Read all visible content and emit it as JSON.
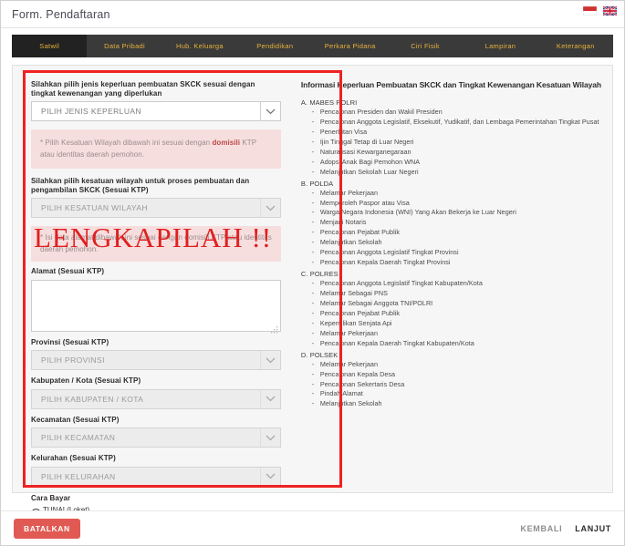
{
  "window": {
    "title": "Form. Pendaftaran"
  },
  "language_flags": [
    {
      "name": "indonesia-flag",
      "label": "Bahasa Indonesia"
    },
    {
      "name": "uk-flag",
      "label": "English"
    }
  ],
  "tabs": [
    {
      "label": "Satwil",
      "active": true
    },
    {
      "label": "Data Pribadi",
      "active": false
    },
    {
      "label": "Hub. Keluarga",
      "active": false
    },
    {
      "label": "Pendidikan",
      "active": false
    },
    {
      "label": "Perkara Pidana",
      "active": false
    },
    {
      "label": "Ciri Fisik",
      "active": false
    },
    {
      "label": "Lampiran",
      "active": false
    },
    {
      "label": "Keterangan",
      "active": false
    }
  ],
  "form": {
    "keperluan": {
      "label": "Silahkan pilih jenis keperluan pembuatan SKCK sesuai dengan tingkat kewenangan yang diperlukan",
      "value": "PILIH JENIS KEPERLUAN",
      "disabled": false
    },
    "alert_wilayah": {
      "prefix": "* Pilih Kesatuan Wilayah dibawah ini sesuai dengan ",
      "highlight": "domisili",
      "suffix": " KTP atau identitas daerah pemohon."
    },
    "kesatuan_wilayah": {
      "label": "Silahkan pilih kesatuan wilayah untuk proses pembuatan dan pengambilan SKCK (Sesuai KTP)",
      "value": "PILIH KESATUAN WILAYAH",
      "disabled": true
    },
    "alert_alamat": {
      "text": "* Isi data alamat dibawah ini sesuai dengan domisili KTP atau identitas daerah pemohon."
    },
    "alamat": {
      "label": "Alamat (Sesuai KTP)",
      "value": ""
    },
    "provinsi": {
      "label": "Provinsi (Sesuai KTP)",
      "value": "PILIH PROVINSI",
      "disabled": true
    },
    "kabupaten": {
      "label": "Kabupaten / Kota (Sesuai KTP)",
      "value": "PILIH KABUPATEN / KOTA",
      "disabled": true
    },
    "kecamatan": {
      "label": "Kecamatan (Sesuai KTP)",
      "value": "PILIH KECAMATAN",
      "disabled": true
    },
    "kelurahan": {
      "label": "Kelurahan (Sesuai KTP)",
      "value": "PILIH KELURAHAN",
      "disabled": true
    },
    "cara_bayar": {
      "label": "Cara Bayar",
      "option": "TUNAI (Loket)",
      "selected": true
    }
  },
  "info": {
    "title": "Informasi Keperluan Pembuatan SKCK dan Tingkat Kewenangan Kesatuan Wilayah",
    "groups": [
      {
        "heading": "A. MABES POLRI",
        "items": [
          "Pencalonan Presiden dan Wakil Presiden",
          "Pencalonan Anggota Legislatif, Eksekutif, Yudikatif, dan Lembaga Pemerintahan Tingkat Pusat",
          "Penerbitan Visa",
          "Ijin Tinggal Tetap di Luar Negeri",
          "Naturalisasi Kewarganegaraan",
          "Adopsi Anak Bagi Pemohon WNA",
          "Melanjutkan Sekolah Luar Negeri"
        ]
      },
      {
        "heading": "B. POLDA",
        "items": [
          "Melamar Pekerjaan",
          "Memperoleh Paspor atau Visa",
          "Warga Negara Indonesia (WNI) Yang Akan Bekerja ke Luar Negeri",
          "Menjadi Notaris",
          "Pencalonan Pejabat Publik",
          "Melanjutkan Sekolah",
          "Pencalonan Anggota Legislatif Tingkat Provinsi",
          "Pencalonan Kepala Daerah Tingkat Provinsi"
        ]
      },
      {
        "heading": "C. POLRES",
        "items": [
          "Pencalonan Anggota Legislatif Tingkat Kabupaten/Kota",
          "Melamar Sebagai PNS",
          "Melamar Sebagai Anggota TNI/POLRI",
          "Pencalonan Pejabat Publik",
          "Kepemilikan Senjata Api",
          "Melamar Pekerjaan",
          "Pencalonan Kepala Daerah Tingkat Kabupaten/Kota"
        ]
      },
      {
        "heading": "D. POLSEK",
        "items": [
          "Melamar Pekerjaan",
          "Pencalonan Kepala Desa",
          "Pencalonan Sekertaris Desa",
          "Pindah Alamat",
          "Melanjutkan Sekolah"
        ]
      }
    ]
  },
  "annotation": {
    "overlay_text": "LENGKAPILAH !!",
    "box_color": "#ee2222",
    "text_color": "#e02020"
  },
  "footer": {
    "cancel_label": "BATALKAN",
    "back_label": "KEMBALI",
    "next_label": "LANJUT"
  }
}
